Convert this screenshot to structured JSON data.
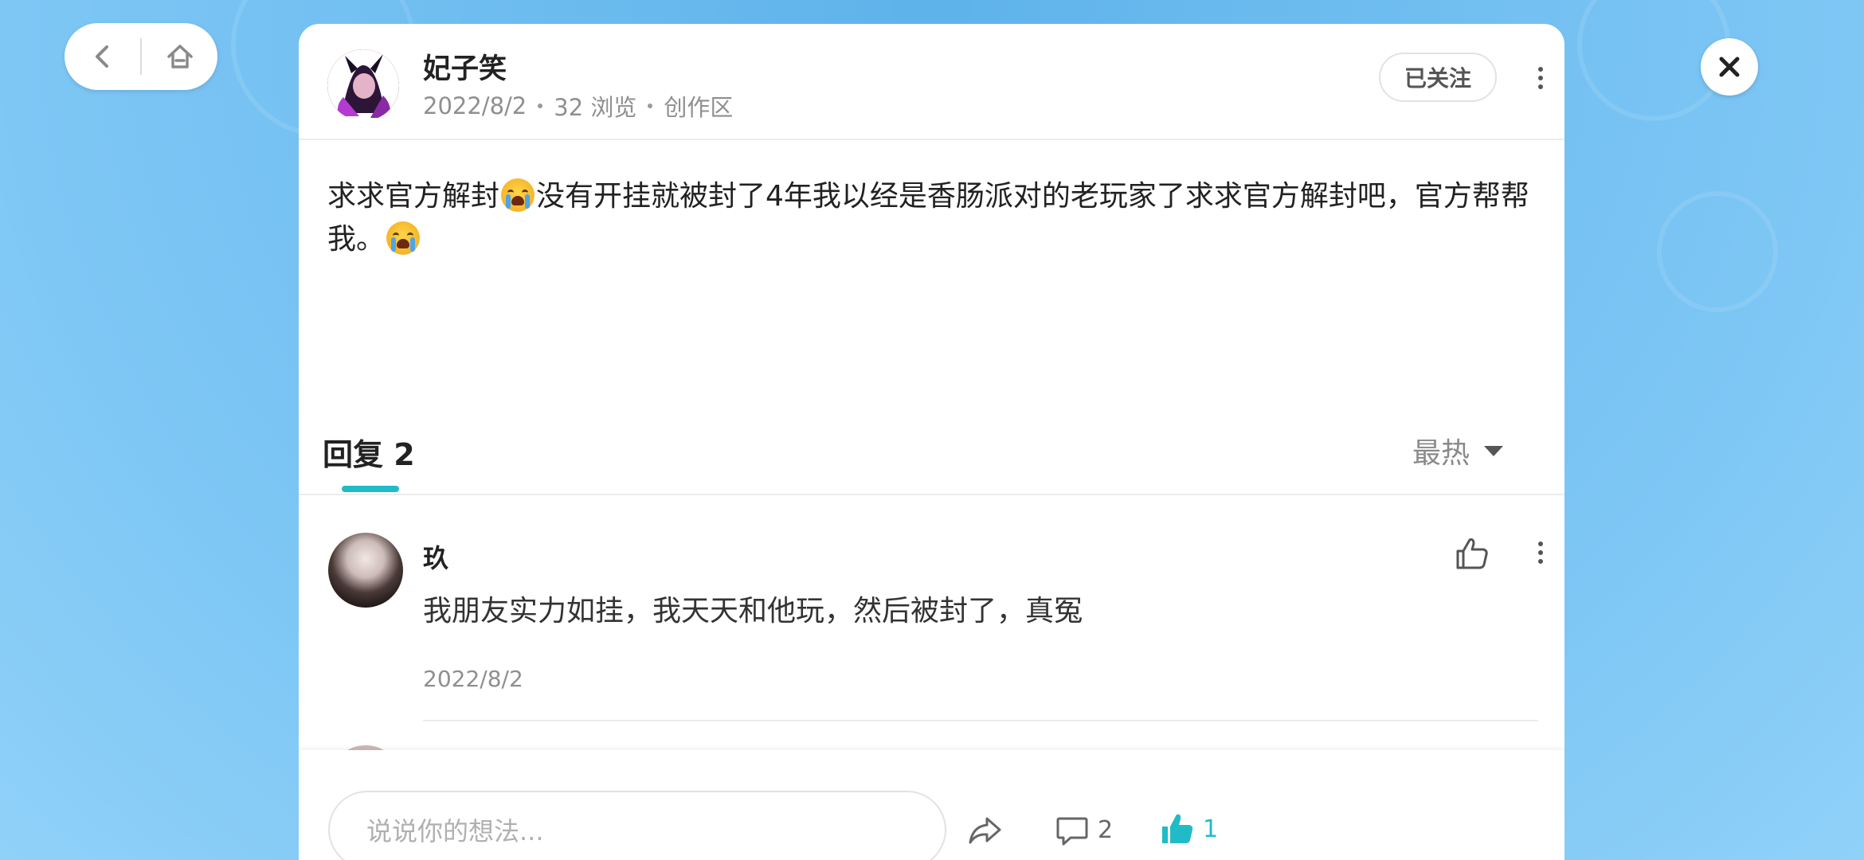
{
  "post": {
    "author": "妃子笑",
    "date": "2022/8/2",
    "views": "32 浏览",
    "section": "创作区",
    "follow_label": "已关注",
    "body_part1": "求求官方解封",
    "body_part2": "没有开挂就被封了4年我以经是香肠派对的老玩家了求求官方解封吧，官方帮帮我。"
  },
  "replies": {
    "title": "回复 2",
    "sort_label": "最热"
  },
  "comment": {
    "name": "玖",
    "text": "我朋友实力如挂，我天天和他玩，然后被封了，真冤",
    "date": "2022/8/2"
  },
  "bottom_bar": {
    "input_placeholder": "说说你的想法...",
    "comment_count": "2",
    "like_count": "1"
  },
  "colors": {
    "accent": "#21bbc8",
    "background": "#6fbdf0"
  }
}
